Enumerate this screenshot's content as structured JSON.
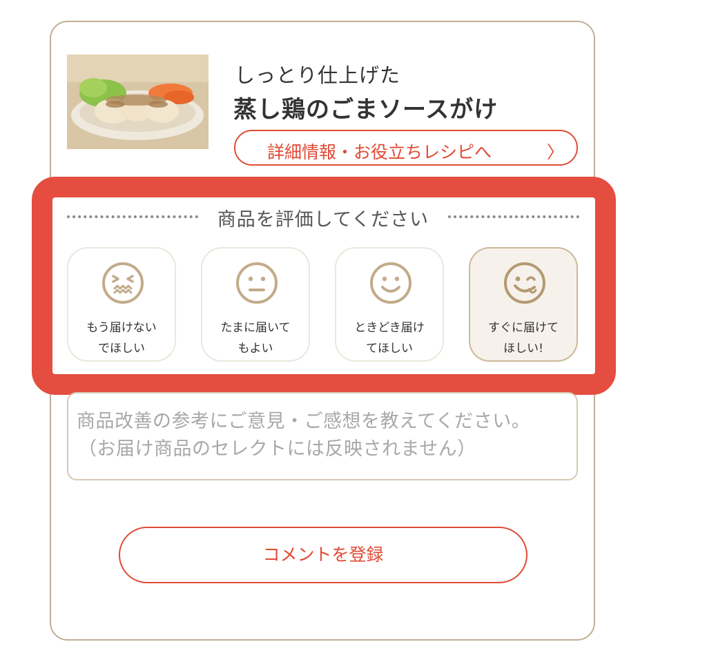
{
  "product": {
    "subtitle": "しっとり仕上げた",
    "title": "蒸し鶏のごまソースがけ",
    "detail_button_label": "詳細情報・お役立ちレシピへ",
    "detail_button_chevron": "〉"
  },
  "rating": {
    "heading": "商品を評価してください",
    "selected_index": 3,
    "options": [
      {
        "icon": "grimace-face-icon",
        "line1": "もう届けない",
        "line2": "でほしい"
      },
      {
        "icon": "neutral-face-icon",
        "line1": "たまに届いて",
        "line2": "もよい"
      },
      {
        "icon": "smile-face-icon",
        "line1": "ときどき届け",
        "line2": "てほしい"
      },
      {
        "icon": "yummy-face-icon",
        "line1": "すぐに届けて",
        "line2": "ほしい!"
      }
    ]
  },
  "comment": {
    "placeholder_line1": "商品改善の参考にご意見・ご感想を教えてください。",
    "placeholder_line2": "（お届け商品のセレクトには反映されません）"
  },
  "submit": {
    "label": "コメントを登録"
  },
  "colors": {
    "accent": "#e04a35",
    "highlight_frame": "#e44d3f",
    "card_border": "#bfae96",
    "icon": "#c2ab8a",
    "selected_bg": "#f6f1ea"
  }
}
